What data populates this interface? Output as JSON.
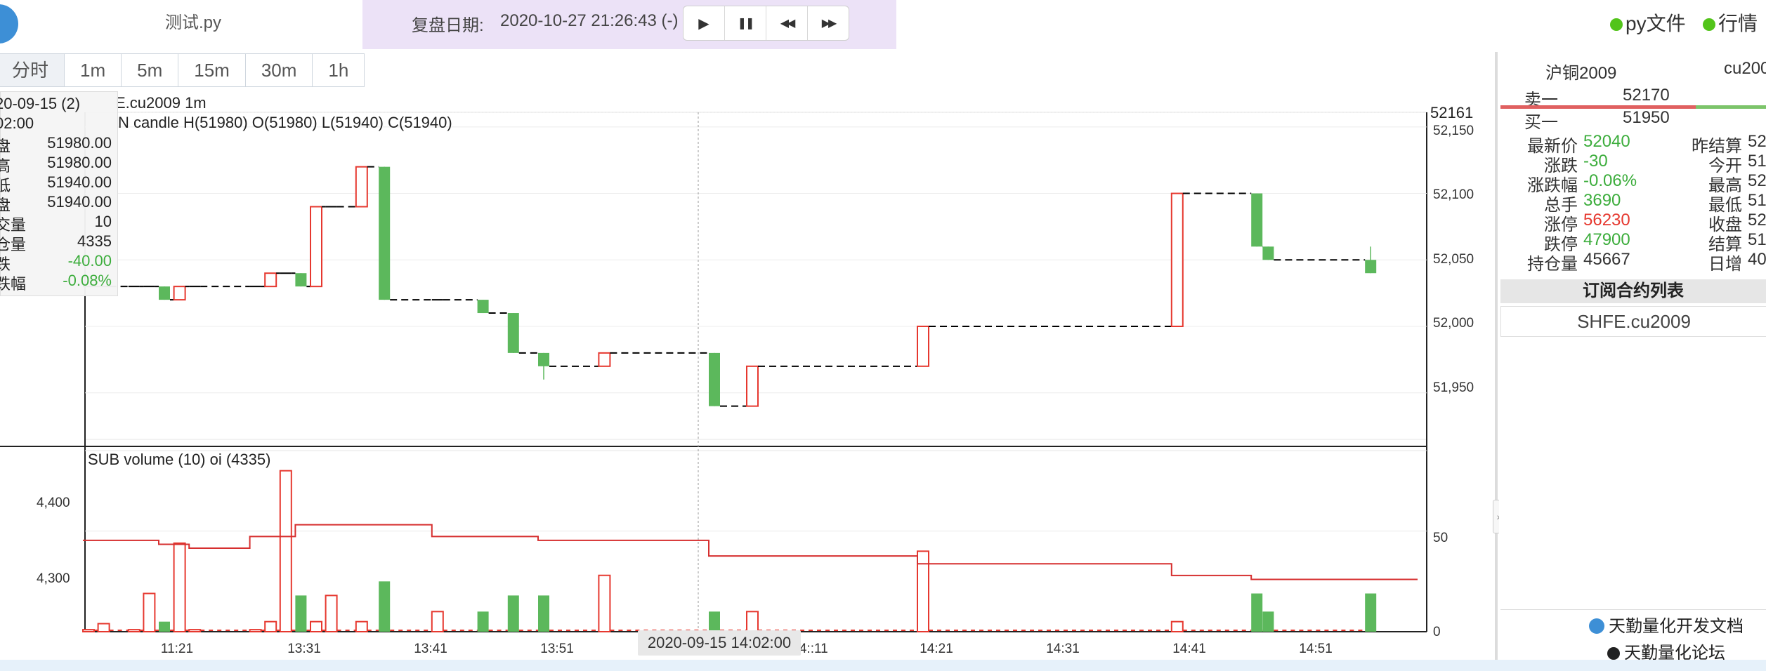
{
  "header": {
    "filename": "测试.py",
    "replay_label": "复盘日期:",
    "replay_datetime": "2020-10-27 21:26:43 (-)",
    "controls": [
      {
        "icon": "play-icon",
        "glyph": "▶"
      },
      {
        "icon": "pause-icon",
        "glyph": "❚❚"
      },
      {
        "icon": "rewind-icon",
        "glyph": "◀◀"
      },
      {
        "icon": "fast-forward-icon",
        "glyph": "▶▶"
      }
    ],
    "links": [
      {
        "label": "py文件",
        "color": "#52c41a"
      },
      {
        "label": "行情",
        "color": "#52c41a"
      }
    ]
  },
  "period_tabs": [
    "分时",
    "1m",
    "5m",
    "15m",
    "30m",
    "1h"
  ],
  "chart": {
    "symbol_label": "E.cu2009 1m",
    "main_legend": "N candle H(51980) O(51980) L(51940) C(51940)",
    "sub_legend": "SUB volume (10) oi (4335)",
    "price_axis": [
      "52,150",
      "52,100",
      "52,050",
      "52,000",
      "51,950"
    ],
    "top_price_label": "52161",
    "volume_axis": [
      "50",
      "0"
    ],
    "oi_axis": [
      "4,400",
      "4,300"
    ],
    "time_axis": [
      "11:21",
      "13:31",
      "13:41",
      "13:51",
      "14::11",
      "14:21",
      "14:31",
      "14:41",
      "14:51"
    ],
    "crosshair_time": "2020-09-15 14:02:00",
    "colors": {
      "up": "#e6382f",
      "down": "#5cb85c",
      "oi_line": "#d62f2f"
    }
  },
  "tooltip": {
    "date": "20-09-15 (2)",
    "time": "02:00",
    "rows": [
      {
        "label": "盘",
        "value": "51980.00"
      },
      {
        "label": "高",
        "value": "51980.00"
      },
      {
        "label": "低",
        "value": "51940.00"
      },
      {
        "label": "盘",
        "value": "51940.00"
      },
      {
        "label": "交量",
        "value": "10"
      },
      {
        "label": "仓量",
        "value": "4335"
      },
      {
        "label": "跌",
        "value": "-40.00"
      },
      {
        "label": "跌幅",
        "value": "-0.08%"
      }
    ]
  },
  "chart_data": {
    "type": "candlestick",
    "candles": [
      {
        "t": 0,
        "o": 52030,
        "c": 52030,
        "h": 52030,
        "l": 52030,
        "vol": 1,
        "oi": 4355
      },
      {
        "t": 4,
        "o": 52030,
        "c": 52030,
        "h": 52030,
        "l": 52030,
        "vol": 4,
        "oi": 4355
      },
      {
        "t": 12,
        "o": 52030,
        "c": 52030,
        "h": 52030,
        "l": 52030,
        "vol": 1,
        "oi": 4355
      },
      {
        "t": 16,
        "o": 52030,
        "c": 52030,
        "h": 52030,
        "l": 52030,
        "vol": 19,
        "oi": 4355
      },
      {
        "t": 20,
        "o": 52030,
        "c": 52020,
        "h": 52030,
        "l": 52020,
        "vol": 5,
        "oi": 4350
      },
      {
        "t": 24,
        "o": 52020,
        "c": 52030,
        "h": 52030,
        "l": 52020,
        "vol": 44,
        "oi": 4350
      },
      {
        "t": 28,
        "o": 52030,
        "c": 52030,
        "h": 52030,
        "l": 52030,
        "vol": 1,
        "oi": 4345
      },
      {
        "t": 44,
        "o": 52030,
        "c": 52030,
        "h": 52030,
        "l": 52030,
        "vol": 1,
        "oi": 4360
      },
      {
        "t": 48,
        "o": 52030,
        "c": 52040,
        "h": 52040,
        "l": 52030,
        "vol": 5,
        "oi": 4360
      },
      {
        "t": 52,
        "o": 52040,
        "c": 52040,
        "h": 52040,
        "l": 52040,
        "vol": 80,
        "oi": 4360
      },
      {
        "t": 56,
        "o": 52040,
        "c": 52030,
        "h": 52040,
        "l": 52030,
        "vol": 18,
        "oi": 4375
      },
      {
        "t": 60,
        "o": 52030,
        "c": 52090,
        "h": 52090,
        "l": 52030,
        "vol": 5,
        "oi": 4375
      },
      {
        "t": 64,
        "o": 52090,
        "c": 52090,
        "h": 52090,
        "l": 52090,
        "vol": 18,
        "oi": 4375
      },
      {
        "t": 72,
        "o": 52090,
        "c": 52120,
        "h": 52120,
        "l": 52090,
        "vol": 5,
        "oi": 4375
      },
      {
        "t": 78,
        "o": 52120,
        "c": 52020,
        "h": 52120,
        "l": 52020,
        "vol": 25,
        "oi": 4375
      },
      {
        "t": 92,
        "o": 52020,
        "c": 52020,
        "h": 52020,
        "l": 52020,
        "vol": 10,
        "oi": 4360
      },
      {
        "t": 104,
        "o": 52020,
        "c": 52010,
        "h": 52020,
        "l": 52010,
        "vol": 10,
        "oi": 4360
      },
      {
        "t": 112,
        "o": 52010,
        "c": 51980,
        "h": 52010,
        "l": 51980,
        "vol": 18,
        "oi": 4360
      },
      {
        "t": 120,
        "o": 51980,
        "c": 51970,
        "h": 51980,
        "l": 51960,
        "vol": 18,
        "oi": 4355
      },
      {
        "t": 136,
        "o": 51970,
        "c": 51980,
        "h": 51980,
        "l": 51970,
        "vol": 28,
        "oi": 4355
      },
      {
        "t": 165,
        "o": 51980,
        "c": 51940,
        "h": 51980,
        "l": 51940,
        "vol": 10,
        "oi": 4335
      },
      {
        "t": 175,
        "o": 51940,
        "c": 51970,
        "h": 51970,
        "l": 51940,
        "vol": 10,
        "oi": 4335
      },
      {
        "t": 220,
        "o": 51970,
        "c": 52000,
        "h": 52000,
        "l": 51970,
        "vol": 40,
        "oi": 4325
      },
      {
        "t": 287,
        "o": 52000,
        "c": 52100,
        "h": 52100,
        "l": 52000,
        "vol": 5,
        "oi": 4310
      },
      {
        "t": 308,
        "o": 52100,
        "c": 52060,
        "h": 52100,
        "l": 52060,
        "vol": 19,
        "oi": 4305
      },
      {
        "t": 311,
        "o": 52060,
        "c": 52050,
        "h": 52060,
        "l": 52050,
        "vol": 10,
        "oi": 4305
      },
      {
        "t": 338,
        "o": 52050,
        "c": 52040,
        "h": 52060,
        "l": 52040,
        "vol": 19,
        "oi": 4305
      }
    ],
    "price_range": [
      51915,
      52161
    ],
    "volume_range": [
      0,
      90
    ],
    "oi_range": [
      4238,
      4470
    ]
  },
  "quote": {
    "name": "沪铜2009",
    "code": "cu200",
    "ask_label": "卖一",
    "ask": "52170",
    "bid_label": "买一",
    "bid": "51950",
    "left": [
      {
        "label": "最新价",
        "value": "52040",
        "color": "green"
      },
      {
        "label": "涨跌",
        "value": "-30",
        "color": "green"
      },
      {
        "label": "涨跌幅",
        "value": "-0.06%",
        "color": "green"
      },
      {
        "label": "总手",
        "value": "3690",
        "color": "green"
      },
      {
        "label": "涨停",
        "value": "56230",
        "color": "red"
      },
      {
        "label": "跌停",
        "value": "47900",
        "color": "green"
      },
      {
        "label": "持仓量",
        "value": "45667",
        "color": "black"
      }
    ],
    "right": [
      {
        "label": "昨结算",
        "value": "52"
      },
      {
        "label": "今开",
        "value": "51"
      },
      {
        "label": "最高",
        "value": "52"
      },
      {
        "label": "最低",
        "value": "51"
      },
      {
        "label": "收盘",
        "value": "52"
      },
      {
        "label": "结算",
        "value": "51"
      },
      {
        "label": "日增",
        "value": "40"
      }
    ]
  },
  "subscriptions": {
    "header": "订阅合约列表",
    "items": [
      "SHFE.cu2009"
    ]
  },
  "footer_links": [
    "天勤量化开发文档",
    "天勤量化论坛"
  ]
}
